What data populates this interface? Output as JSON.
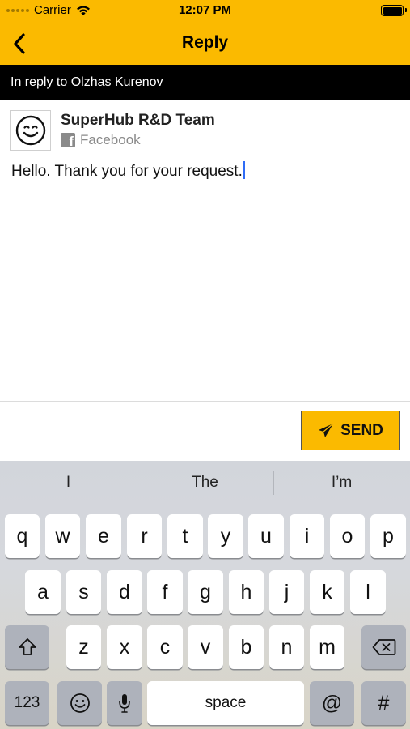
{
  "status_bar": {
    "carrier": "Carrier",
    "time": "12:07 PM"
  },
  "nav": {
    "title": "Reply"
  },
  "reply_banner": "In reply to Olzhas Kurenov",
  "sender": {
    "name": "SuperHub R&D Team",
    "source": "Facebook"
  },
  "message": {
    "text": "Hello. Thank you for your request."
  },
  "send_button": {
    "label": "SEND"
  },
  "keyboard": {
    "suggestions": [
      "I",
      "The",
      "I’m"
    ],
    "row1": [
      "q",
      "w",
      "e",
      "r",
      "t",
      "y",
      "u",
      "i",
      "o",
      "p"
    ],
    "row2": [
      "a",
      "s",
      "d",
      "f",
      "g",
      "h",
      "j",
      "k",
      "l"
    ],
    "row3": [
      "z",
      "x",
      "c",
      "v",
      "b",
      "n",
      "m"
    ],
    "numbers_key": "123",
    "space_key": "space",
    "at_key": "@",
    "hash_key": "#"
  },
  "colors": {
    "accent": "#FBBA00",
    "banner": "#000000"
  }
}
